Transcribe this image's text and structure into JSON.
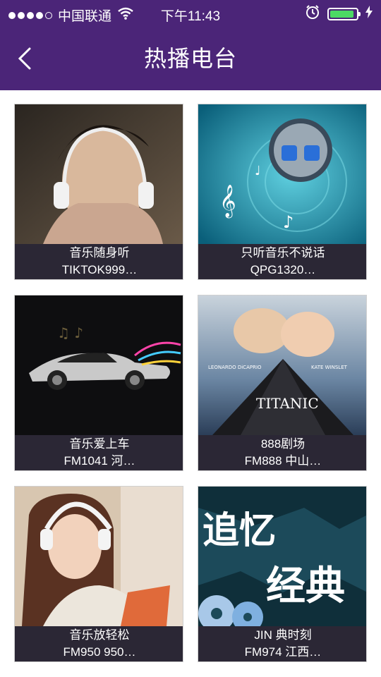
{
  "status": {
    "carrier": "中国联通",
    "time": "下午11:43",
    "battery_level": 0.9,
    "battery_color": "#4cd964"
  },
  "nav": {
    "title": "热播电台",
    "back_icon": "chevron-left-icon",
    "bar_color": "#4b2578"
  },
  "stations": [
    {
      "name": "音乐随身听",
      "sub": "TIKTOK999…"
    },
    {
      "name": "只听音乐不说话",
      "sub": "QPG1320…"
    },
    {
      "name": "音乐爱上车",
      "sub": "FM1041 河…"
    },
    {
      "name": "888剧场",
      "sub": "FM888  中山…"
    },
    {
      "name": "音乐放轻松",
      "sub": "FM950  950…"
    },
    {
      "name": "JIN 典时刻",
      "sub": "FM974  江西…"
    }
  ],
  "art_text": {
    "titanic_title": "TITANIC",
    "titanic_actor_left": "LEONARDO DiCAPRIO",
    "titanic_actor_right": "KATE WINSLET",
    "jin_line1": "追忆",
    "jin_line2": "经典"
  }
}
